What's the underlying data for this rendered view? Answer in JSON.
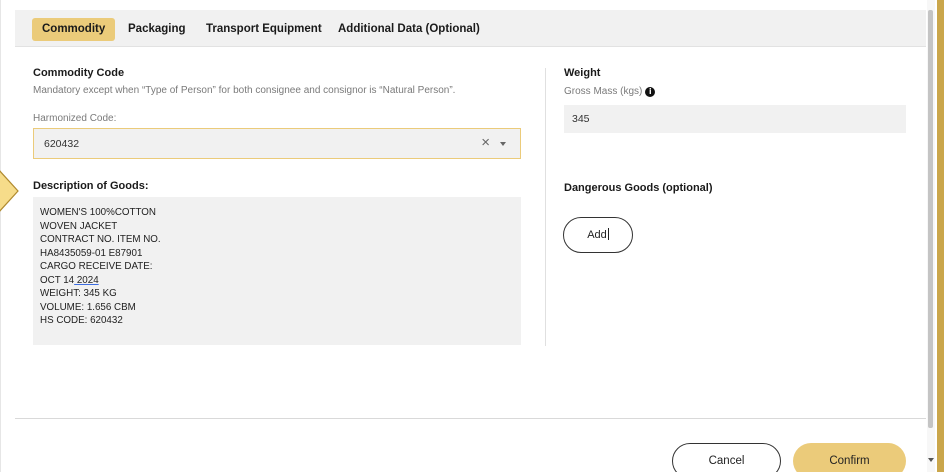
{
  "tabs": [
    {
      "label": "Commodity",
      "active": true
    },
    {
      "label": "Packaging",
      "active": false
    },
    {
      "label": "Transport Equipment",
      "active": false
    },
    {
      "label": "Additional Data (Optional)",
      "active": false
    }
  ],
  "commodity_code": {
    "title": "Commodity Code",
    "note": "Mandatory except when “Type of Person” for both consignee and consignor is “Natural Person”.",
    "hs_label": "Harmonized Code:",
    "hs_value": "620432",
    "clear_icon": "×",
    "dropdown_icon": "chevron-down-icon"
  },
  "description": {
    "title": "Description of Goods:",
    "lines": [
      "WOMEN'S 100%COTTON",
      "WOVEN JACKET",
      "CONTRACT NO. ITEM NO.",
      "HA8435059-01 E87901",
      "CARGO RECEIVE DATE:",
      "OCT 14",
      "WEIGHT: 345 KG",
      "VOLUME: 1.656 CBM",
      "HS CODE: 620432"
    ],
    "line6_underlined": " 2024"
  },
  "weight": {
    "title": "Weight",
    "gross_label": "Gross Mass (kgs)",
    "gross_value": "345",
    "info_icon": "i"
  },
  "dangerous_goods": {
    "title": "Dangerous Goods (optional)",
    "add_label": "Add"
  },
  "footer": {
    "cancel_label": "Cancel",
    "confirm_label": "Confirm"
  },
  "colors": {
    "accent": "#ebcb7a",
    "field_bg": "#f1f1f1",
    "spellcheck_underline": "#3d6de0"
  }
}
